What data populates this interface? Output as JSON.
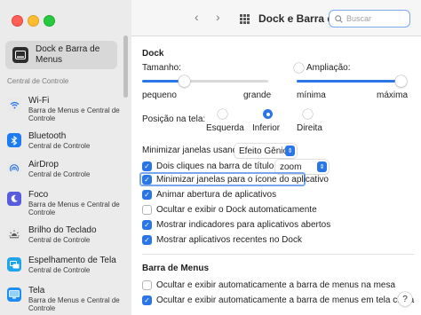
{
  "toolbar": {
    "back": "‹",
    "forward": "›",
    "title": "Dock e Barra de Menus",
    "search_placeholder": "Buscar"
  },
  "sidebar": {
    "selected": {
      "label": "Dock e Barra de Menus"
    },
    "section": "Central de Controle",
    "items": [
      {
        "title": "Wi-Fi",
        "subtitle": "Barra de Menus e Central de Controle",
        "icon": "wifi-icon",
        "color": "#e9e9e9"
      },
      {
        "title": "Bluetooth",
        "subtitle": "Central de Controle",
        "icon": "bluetooth-icon",
        "color": "#1e7cf2"
      },
      {
        "title": "AirDrop",
        "subtitle": "Central de Controle",
        "icon": "airdrop-icon",
        "color": "#e9e9e9"
      },
      {
        "title": "Foco",
        "subtitle": "Barra de Menus e Central de Controle",
        "icon": "moon-icon",
        "color": "#5a5ce0"
      },
      {
        "title": "Brilho do Teclado",
        "subtitle": "Central de Controle",
        "icon": "keyboard-brightness-icon",
        "color": "#e9e9e9"
      },
      {
        "title": "Espelhamento de Tela",
        "subtitle": "Central de Controle",
        "icon": "screen-mirroring-icon",
        "color": "#1ea4ea"
      },
      {
        "title": "Tela",
        "subtitle": "Barra de Menus e Central de Controle",
        "icon": "display-icon",
        "color": "#1e8cf0"
      }
    ]
  },
  "dock": {
    "heading": "Dock",
    "size_label": "Tamanho:",
    "size_min": "pequeno",
    "size_max": "grande",
    "size_value": 0.33,
    "magnification_label": "Ampliação:",
    "magnification_checked": false,
    "magnification_min": "mínima",
    "magnification_max": "máxima",
    "magnification_value": 1.0,
    "position_label": "Posição na tela:",
    "positions": [
      "Esquerda",
      "Inferior",
      "Direita"
    ],
    "position_selected": "Inferior",
    "minimize_label": "Minimizar janelas usando:",
    "minimize_value": "Efeito Gênio",
    "double_click_label": "Dois cliques na barra de título para",
    "double_click_value": "zoom",
    "checkboxes": [
      {
        "label": "Minimizar janelas para o ícone do aplicativo",
        "checked": true
      },
      {
        "label": "Animar abertura de aplicativos",
        "checked": true
      },
      {
        "label": "Ocultar e exibir o Dock automaticamente",
        "checked": false
      },
      {
        "label": "Mostrar indicadores para aplicativos abertos",
        "checked": true
      },
      {
        "label": "Mostrar aplicativos recentes no Dock",
        "checked": true
      }
    ]
  },
  "menubar": {
    "heading": "Barra de Menus",
    "checkboxes": [
      {
        "label": "Ocultar e exibir automaticamente a barra de menus na mesa",
        "checked": false
      },
      {
        "label": "Ocultar e exibir automaticamente a barra de menus em tela cheia",
        "checked": true
      }
    ]
  },
  "help": "?"
}
